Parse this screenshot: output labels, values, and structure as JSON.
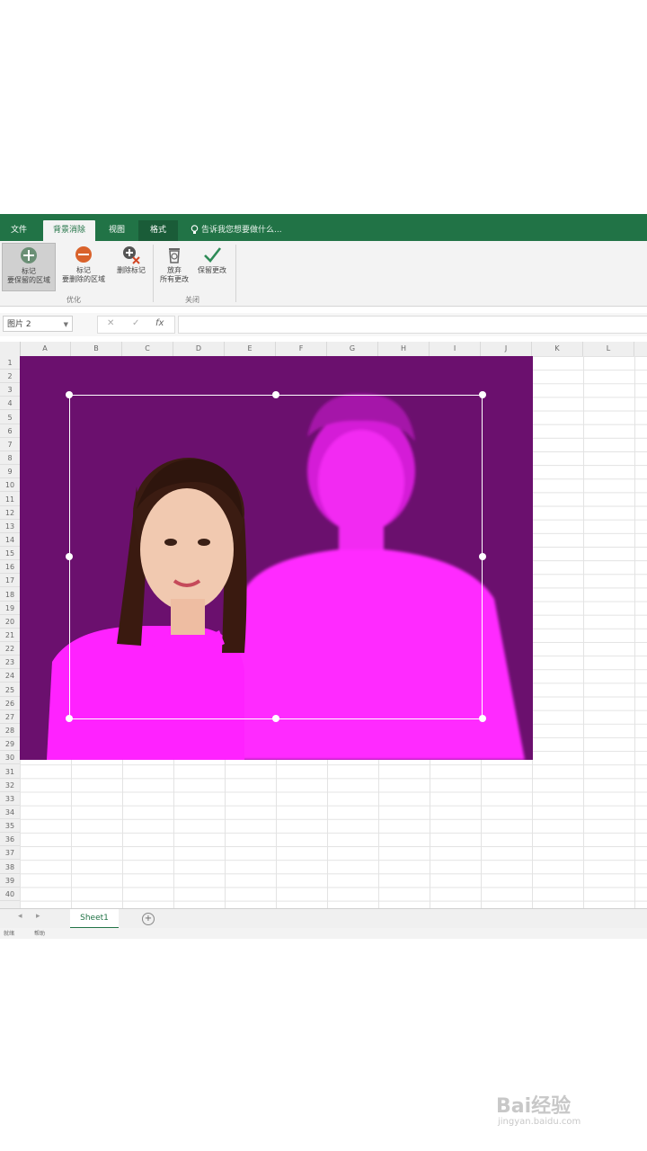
{
  "ribbon_tabs": [
    "文件",
    "背景消除",
    "视图",
    "格式"
  ],
  "tell_me": "告诉我您想要做什么...",
  "ribbon": {
    "buttons": [
      {
        "label1": "标记",
        "label2": "要保留的区域"
      },
      {
        "label1": "标记",
        "label2": "要删除的区域"
      },
      {
        "label1": "删除标记",
        "label2": ""
      },
      {
        "label1": "放弃",
        "label2": "所有更改"
      },
      {
        "label1": "保留更改",
        "label2": ""
      }
    ],
    "groups": [
      "优化",
      "关闭"
    ]
  },
  "formula_bar": {
    "name_box": "图片 2",
    "cancel": "✕",
    "enter": "✓",
    "fx": "fx"
  },
  "columns": [
    "A",
    "B",
    "C",
    "D",
    "E",
    "F",
    "G",
    "H",
    "I",
    "J",
    "K",
    "L"
  ],
  "rows": [
    "1",
    "2",
    "3",
    "4",
    "5",
    "6",
    "7",
    "8",
    "9",
    "10",
    "11",
    "12",
    "13",
    "14",
    "15",
    "16",
    "17",
    "18",
    "19",
    "20",
    "21",
    "22",
    "23",
    "24",
    "25",
    "26",
    "27",
    "28",
    "29",
    "30",
    "31",
    "32",
    "33",
    "34",
    "35",
    "36",
    "37",
    "38",
    "39",
    "40"
  ],
  "sheet_tab": "Sheet1",
  "add_sheet": "+",
  "status": {
    "left": "就绪",
    "mid": "帮助"
  },
  "colors": {
    "excel_green": "#217346",
    "picture_bg": "#6b106e",
    "removed_overlay": "#ff22ff"
  },
  "watermark": {
    "logo": "Bai经验",
    "url": "jingyan.baidu.com"
  }
}
